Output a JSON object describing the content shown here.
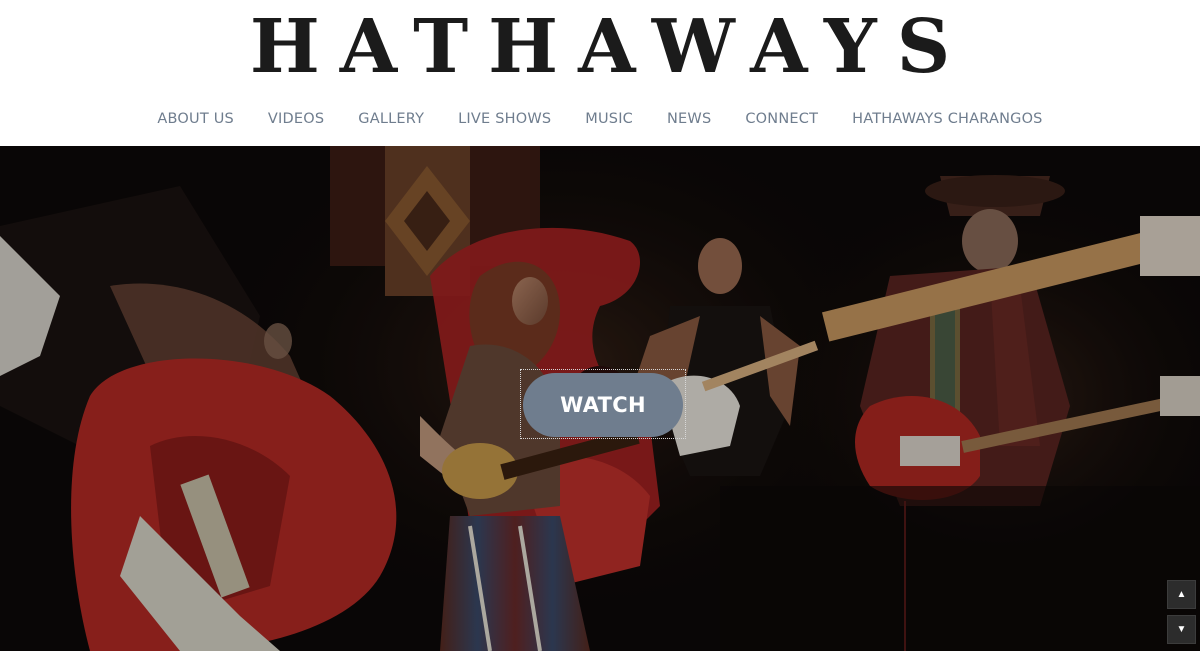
{
  "header": {
    "logo_text": "HATHAWAYS"
  },
  "nav": {
    "items": [
      {
        "label": "ABOUT US"
      },
      {
        "label": "VIDEOS"
      },
      {
        "label": "GALLERY"
      },
      {
        "label": "LIVE SHOWS"
      },
      {
        "label": "MUSIC"
      },
      {
        "label": "NEWS"
      },
      {
        "label": "CONNECT"
      },
      {
        "label": "HATHAWAYS CHARANGOS"
      }
    ],
    "color": "#6f7d8e"
  },
  "hero": {
    "watch_label": "WATCH",
    "button_color": "#6f7d8e",
    "image_description_icon": "band-performance-photo",
    "scroll_up_glyph": "▲",
    "scroll_down_glyph": "▼"
  }
}
